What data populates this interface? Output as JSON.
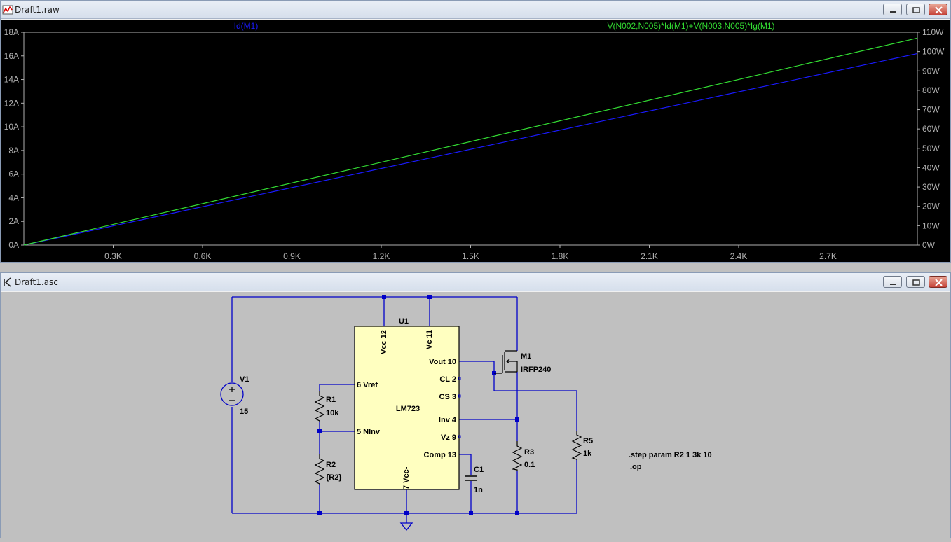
{
  "waveform_window": {
    "title": "Draft1.raw",
    "trace1_label": "Id(M1)",
    "trace2_label": "V(N002,N005)*Id(M1)+V(N003,N005)*Ig(M1)",
    "trace1_color": "#1a1aff",
    "trace2_color": "#33dd33",
    "background": "#000000"
  },
  "schematic_window": {
    "title": "Draft1.asc",
    "background": "#c0c0c0",
    "wire_color": "#0000c8",
    "ic_fill": "#ffffc0"
  },
  "window_buttons": [
    "minimize-icon",
    "restore-icon",
    "close-icon"
  ],
  "chart_data": {
    "type": "line",
    "x_axis": {
      "ticks": [
        "0.3K",
        "0.6K",
        "0.9K",
        "1.2K",
        "1.5K",
        "1.8K",
        "2.1K",
        "2.4K",
        "2.7K"
      ],
      "xlim": [
        0,
        3000
      ]
    },
    "y_left": {
      "ticks": [
        "0A",
        "2A",
        "4A",
        "6A",
        "8A",
        "10A",
        "12A",
        "14A",
        "16A",
        "18A"
      ],
      "ylim": [
        0,
        18
      ]
    },
    "y_right": {
      "ticks": [
        "0W",
        "10W",
        "20W",
        "30W",
        "40W",
        "50W",
        "60W",
        "70W",
        "80W",
        "90W",
        "100W",
        "110W"
      ],
      "ylim": [
        0,
        110
      ]
    },
    "grid": false,
    "series": [
      {
        "name": "Id(M1)",
        "axis": "left",
        "color": "#1a1aff",
        "x": [
          0,
          3000
        ],
        "y": [
          0,
          16.2
        ]
      },
      {
        "name": "V(N002,N005)*Id(M1)+V(N003,N005)*Ig(M1)",
        "axis": "right",
        "color": "#33dd33",
        "x": [
          0,
          3000
        ],
        "y": [
          0,
          107
        ]
      }
    ]
  },
  "schematic": {
    "ic": {
      "ref": "U1",
      "name": "LM723",
      "pins": {
        "vcc": "Vcc 12",
        "vc": "Vc 11",
        "vref": "6 Vref",
        "ninv": "5 NInv",
        "vout": "Vout 10",
        "cl": "CL 2",
        "cs": "CS 3",
        "inv": "Inv 4",
        "vz": "Vz 9",
        "comp": "Comp 13",
        "vcc_neg": "7 Vcc-"
      }
    },
    "v1": {
      "ref": "V1",
      "value": "15"
    },
    "r1": {
      "ref": "R1",
      "value": "10k"
    },
    "r2": {
      "ref": "R2",
      "value": "{R2}"
    },
    "r3": {
      "ref": "R3",
      "value": "0.1"
    },
    "r5": {
      "ref": "R5",
      "value": "1k"
    },
    "c1": {
      "ref": "C1",
      "value": "1n"
    },
    "m1": {
      "ref": "M1",
      "value": "IRFP240"
    },
    "directives": [
      ".step param R2 1 3k 10",
      ".op"
    ]
  }
}
